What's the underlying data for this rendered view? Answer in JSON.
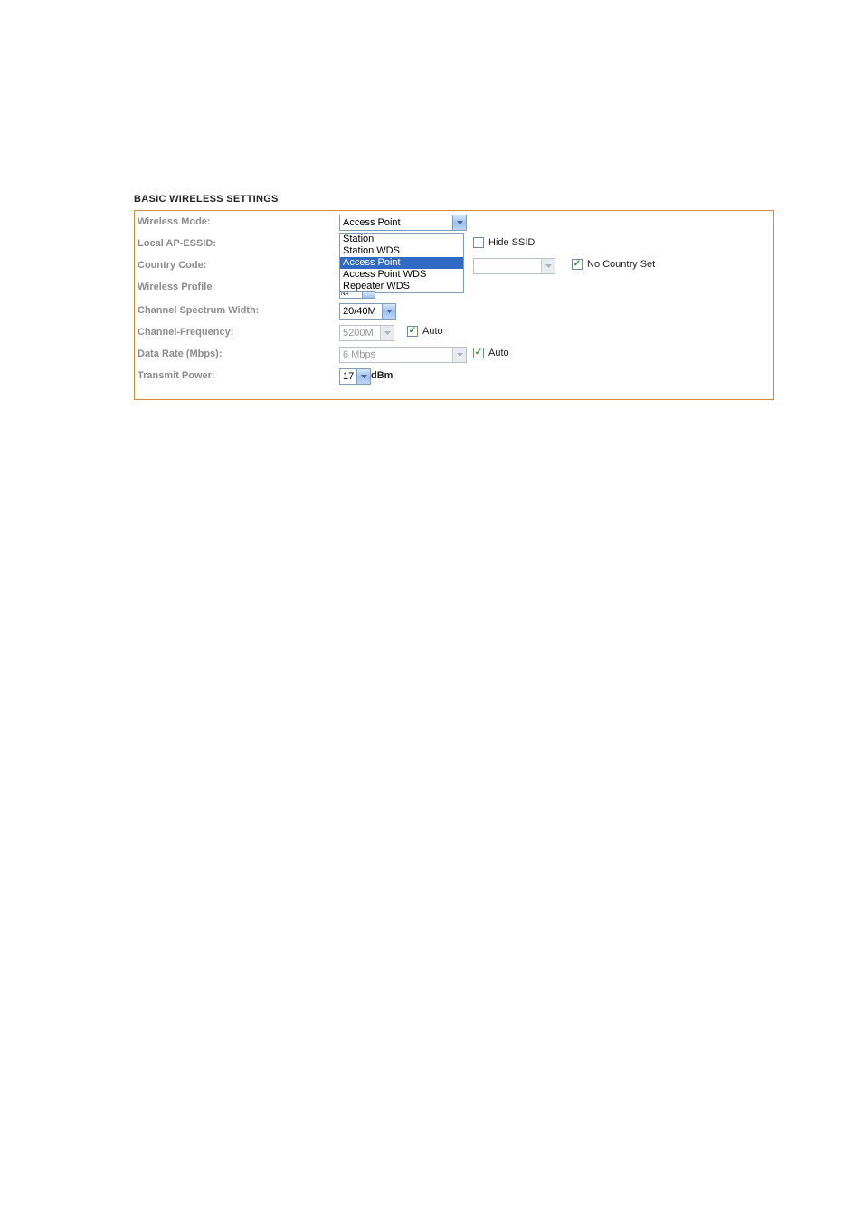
{
  "section_title": "BASIC WIRELESS SETTINGS",
  "labels": {
    "wireless_mode": "Wireless Mode:",
    "local_ap_essid": "Local AP-ESSID:",
    "country_code": "Country Code:",
    "wireless_profile": "Wireless Profile",
    "channel_spectrum_width": "Channel Spectrum Width:",
    "channel_frequency": "Channel-Frequency:",
    "data_rate": "Data Rate (Mbps):",
    "transmit_power": "Transmit Power:"
  },
  "wireless_mode": {
    "value": "Access Point",
    "options": [
      "Station",
      "Station WDS",
      "Access Point",
      "Access Point WDS",
      "Repeater WDS"
    ]
  },
  "hide_ssid": {
    "label": "Hide SSID",
    "checked": false
  },
  "no_country_set": {
    "label": "No Country Set",
    "checked": true
  },
  "channel_spectrum_width": {
    "value": "20/40M"
  },
  "channel_frequency": {
    "value": "5200M"
  },
  "channel_frequency_auto": {
    "label": "Auto",
    "checked": true
  },
  "data_rate": {
    "value": "6 Mbps"
  },
  "data_rate_auto": {
    "label": "Auto",
    "checked": true
  },
  "transmit_power": {
    "value": "17",
    "unit": "dBm"
  }
}
